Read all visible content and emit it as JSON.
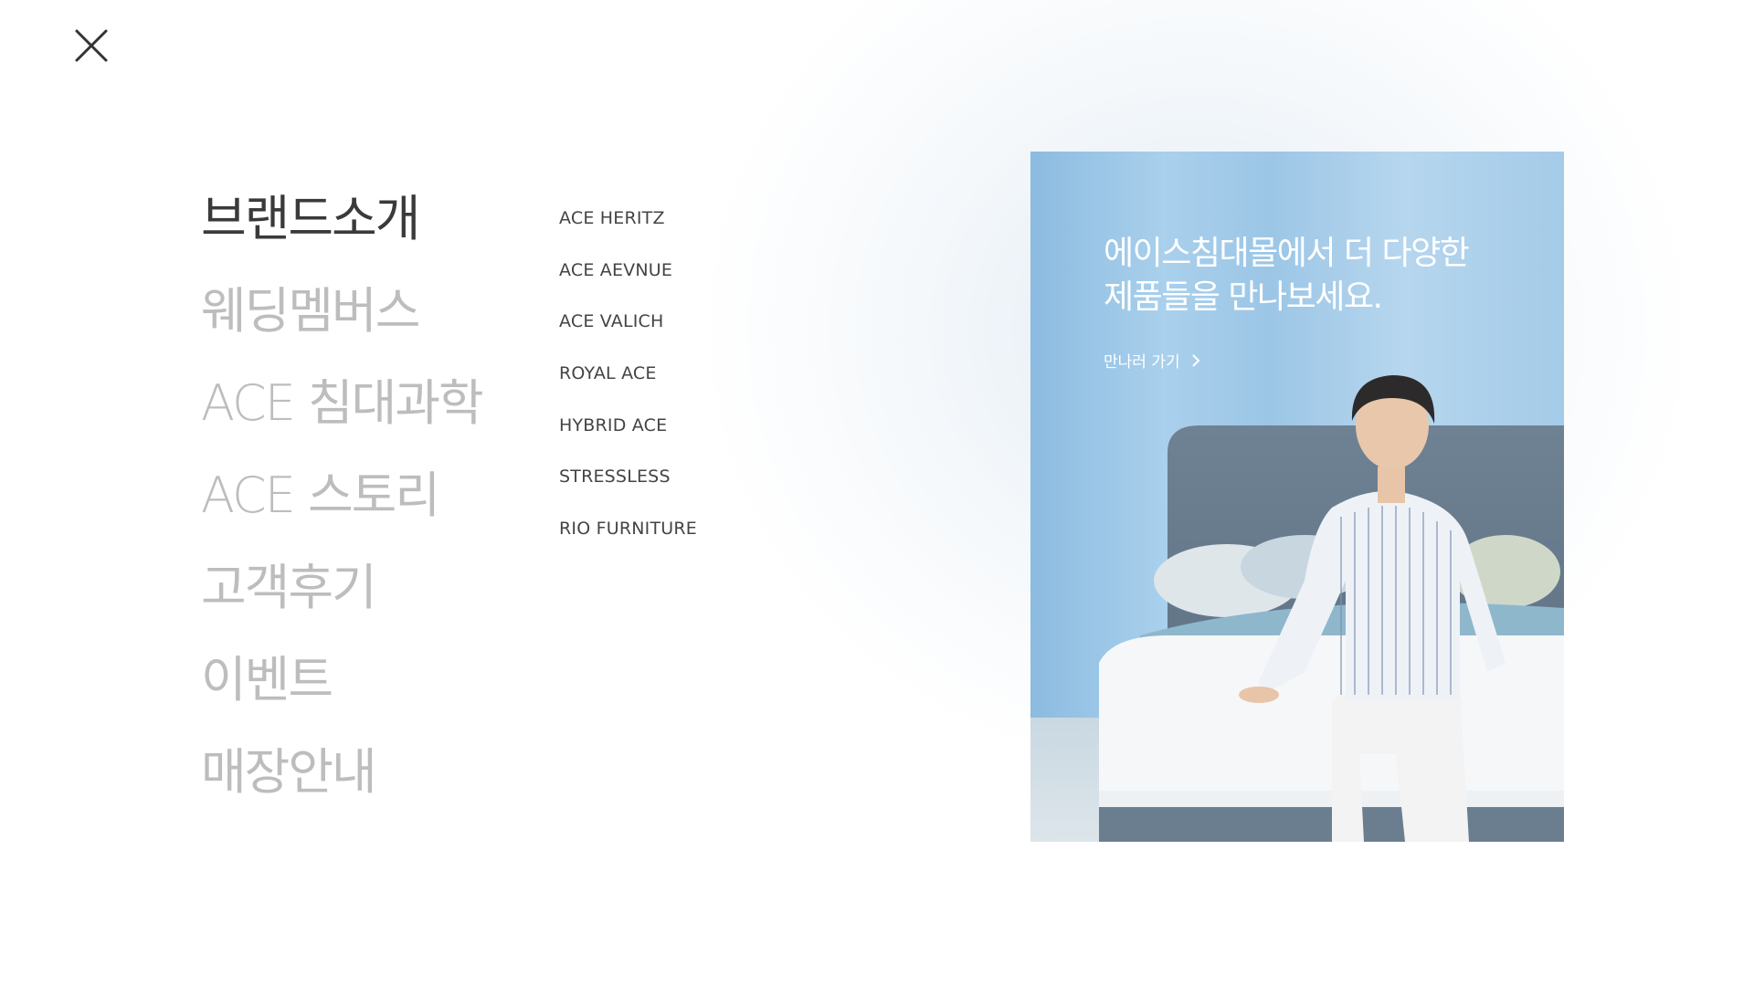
{
  "close_icon": "close-icon",
  "main_menu": [
    {
      "label": "브랜드소개",
      "active": true
    },
    {
      "label": "웨딩멤버스",
      "active": false
    },
    {
      "label": "ACE 침대과학",
      "active": false
    },
    {
      "label": "ACE 스토리",
      "active": false
    },
    {
      "label": "고객후기",
      "active": false
    },
    {
      "label": "이벤트",
      "active": false
    },
    {
      "label": "매장안내",
      "active": false
    }
  ],
  "sub_menu": [
    "ACE HERITZ",
    "ACE AEVNUE",
    "ACE VALICH",
    "ROYAL ACE",
    "HYBRID ACE",
    "STRESSLESS",
    "RIO FURNITURE"
  ],
  "promo": {
    "title_line1": "에이스침대몰에서 더 다양한",
    "title_line2": "제품들을 만나보세요.",
    "link_label": "만나러 가기",
    "link_icon": "chevron-right-icon"
  },
  "colors": {
    "active_menu": "#3a3a3a",
    "inactive_menu": "#bdbdbd",
    "sub_menu": "#444444",
    "promo_bg": "#a7cde9"
  }
}
